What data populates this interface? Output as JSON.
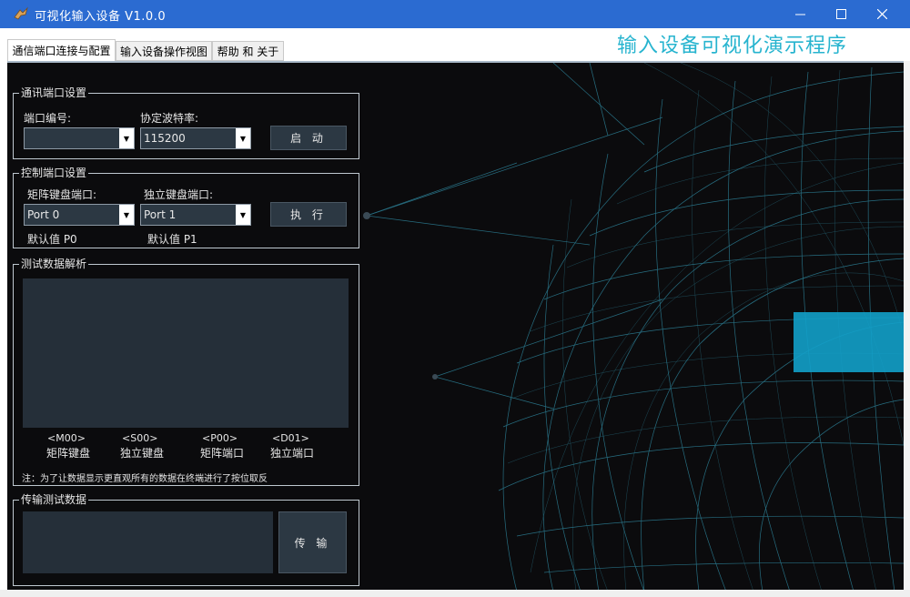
{
  "window": {
    "title": "可视化输入设备 V1.0.0",
    "controls": [
      "minimize-icon",
      "maximize-icon",
      "close-icon"
    ]
  },
  "tabs": [
    {
      "label": "通信端口连接与配置",
      "active": true
    },
    {
      "label": "输入设备操作视图",
      "active": false
    },
    {
      "label": "帮助 和 关于",
      "active": false
    }
  ],
  "header_title": "输入设备可视化演示程序",
  "comm_group": {
    "title": "通讯端口设置",
    "port_label": "端口编号:",
    "port_value": "",
    "baud_label": "协定波特率:",
    "baud_value": "115200",
    "start_button": "启 动"
  },
  "control_group": {
    "title": "控制端口设置",
    "matrix_label": "矩阵键盘端口:",
    "matrix_value": "Port 0",
    "matrix_default": "默认值 P0",
    "indep_label": "独立键盘端口:",
    "indep_value": "Port 1",
    "indep_default": "默认值 P1",
    "exec_button": "执 行"
  },
  "test_group": {
    "title": "测试数据解析",
    "legend": [
      {
        "code": "<M00>",
        "name": "矩阵键盘"
      },
      {
        "code": "<S00>",
        "name": "独立键盘"
      },
      {
        "code": "<P00>",
        "name": "矩阵端口"
      },
      {
        "code": "<D01>",
        "name": "独立端口"
      }
    ],
    "note": "注：为了让数据显示更直观所有的数据在终端进行了按位取反"
  },
  "transmit_group": {
    "title": "传输测试数据",
    "send_button": "传 输"
  },
  "colors": {
    "title_bar": "#2b6bd1",
    "header_title": "#27b4cf",
    "background": "#0b0b0d",
    "panel": "#252f39",
    "mesh": "#2c7f95"
  }
}
